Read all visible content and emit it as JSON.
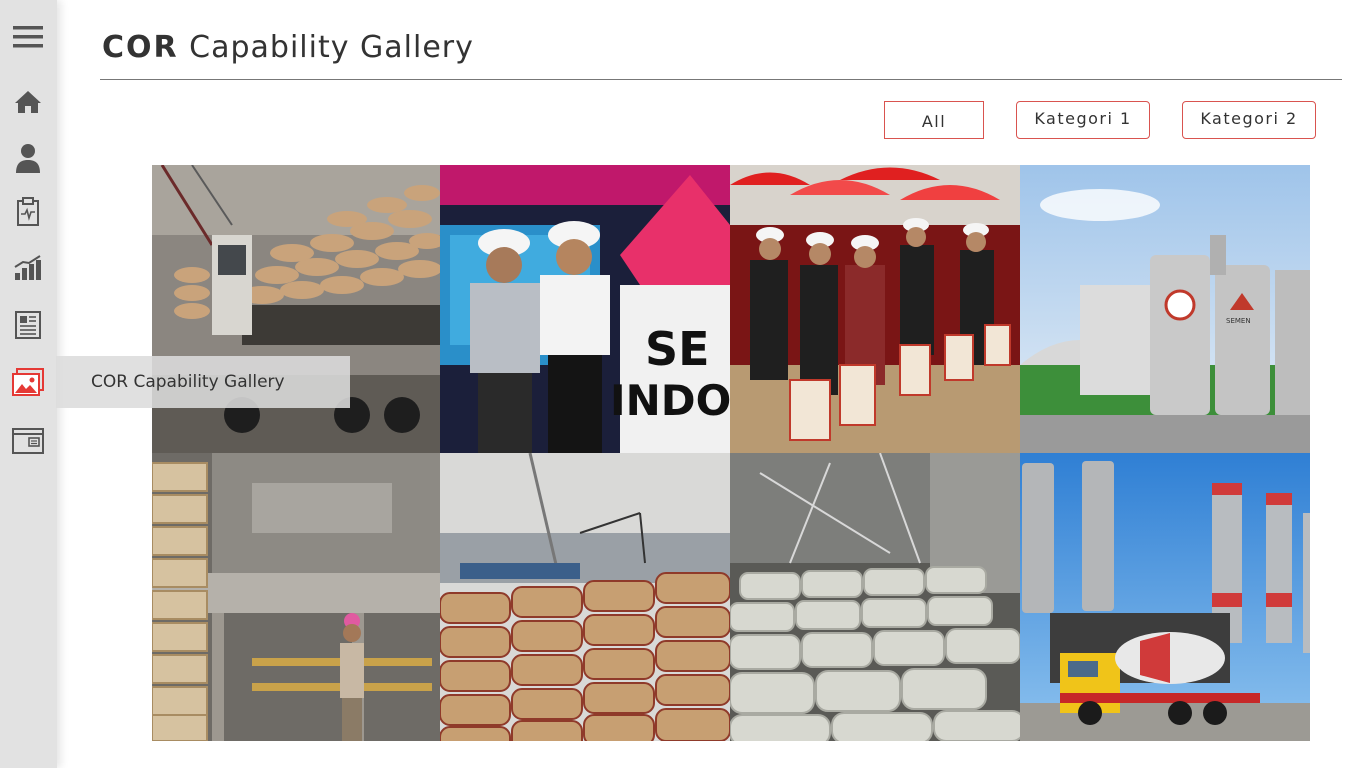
{
  "page": {
    "title_bold": "COR",
    "title_rest": " Capability Gallery"
  },
  "sidebar": {
    "items": [
      {
        "icon": "hamburger-menu-icon",
        "active": false
      },
      {
        "icon": "home-icon",
        "active": false
      },
      {
        "icon": "user-icon",
        "active": false
      },
      {
        "icon": "clipboard-icon",
        "active": false
      },
      {
        "icon": "bar-chart-icon",
        "active": false
      },
      {
        "icon": "newspaper-icon",
        "active": false
      },
      {
        "icon": "gallery-icon",
        "active": true
      },
      {
        "icon": "window-icon",
        "active": false
      }
    ],
    "tooltip": "COR Capability Gallery",
    "active_color": "#e53935",
    "icon_color": "#555555"
  },
  "filters": {
    "all": "All",
    "kategori1": "Kategori 1",
    "kategori2": "Kategori 2",
    "border_color": "#d9534f"
  },
  "gallery": {
    "images": [
      {
        "name": "cement-truck-photo"
      },
      {
        "name": "officials-hardhats-photo"
      },
      {
        "name": "groundbreaking-ceremony-photo"
      },
      {
        "name": "cement-silos-plant-photo"
      },
      {
        "name": "cement-warehouse-worker-photo"
      },
      {
        "name": "cement-sacks-port-photo"
      },
      {
        "name": "stacked-cement-bags-photo"
      },
      {
        "name": "semen-gresik-mixer-truck-photo"
      }
    ]
  }
}
